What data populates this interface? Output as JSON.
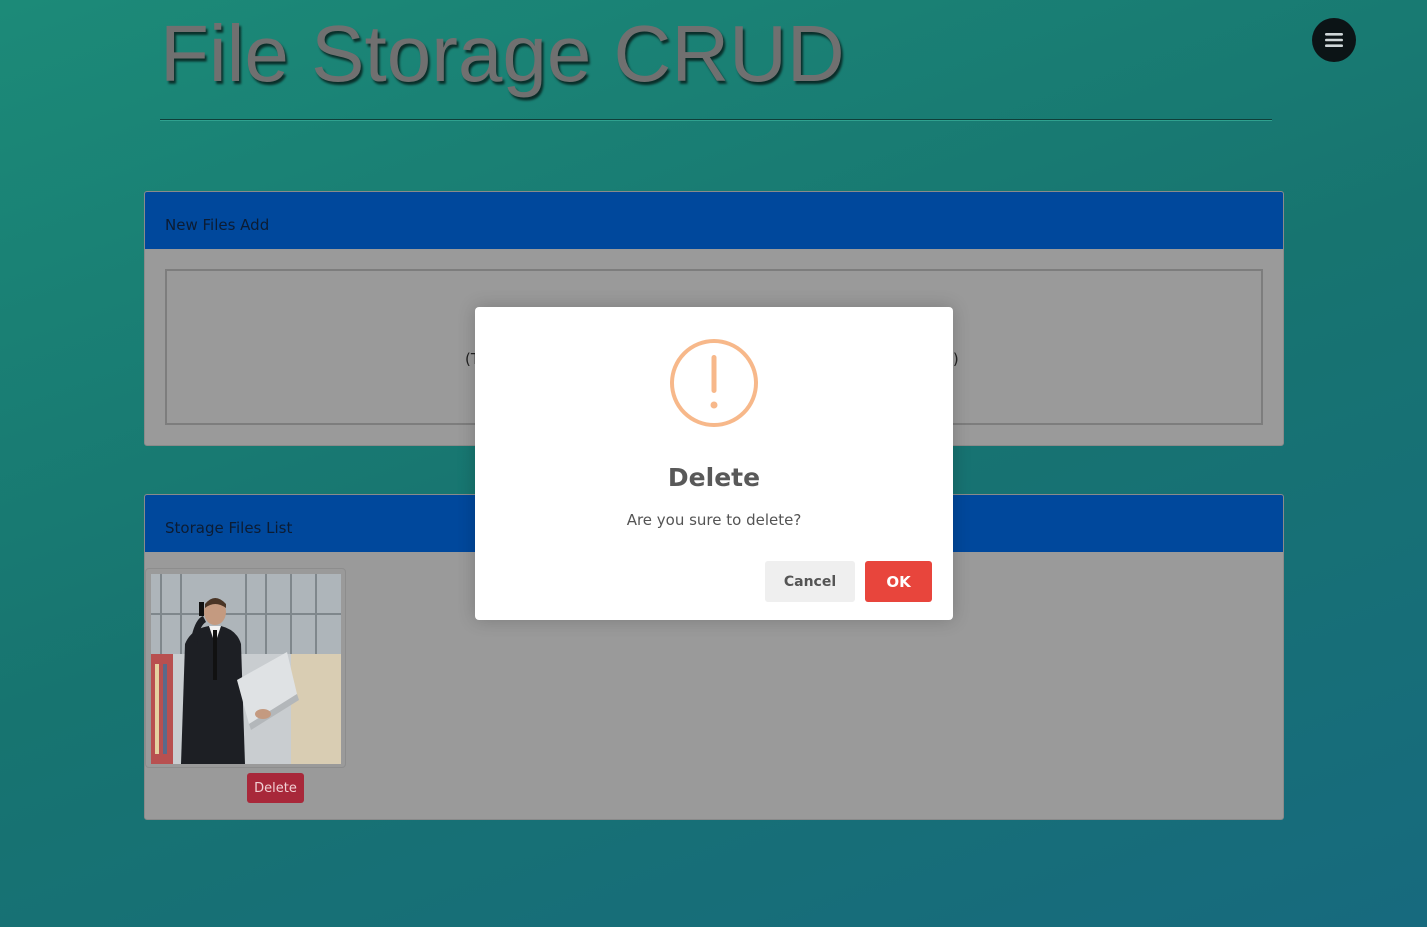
{
  "header": {
    "title": "File Storage CRUD",
    "menu_icon": "hamburger-menu-icon"
  },
  "add_card": {
    "title": "New Files Add",
    "drop_text_left": "(T",
    "drop_text_right": "l.)"
  },
  "list_card": {
    "title": "Storage Files List",
    "files": [
      {
        "image_subject": "businessman-on-phone-with-laptop",
        "delete_label": "Delete"
      }
    ]
  },
  "dialog": {
    "icon": "warning-icon",
    "title": "Delete",
    "message": "Are you sure to delete?",
    "cancel_label": "Cancel",
    "ok_label": "OK"
  },
  "colors": {
    "background": "#177470",
    "card_header": "#00489c",
    "card_body": "#9a9a9a",
    "delete_button": "#a8283a",
    "ok_button": "#e8453c",
    "warning_icon": "#f7b88a"
  }
}
